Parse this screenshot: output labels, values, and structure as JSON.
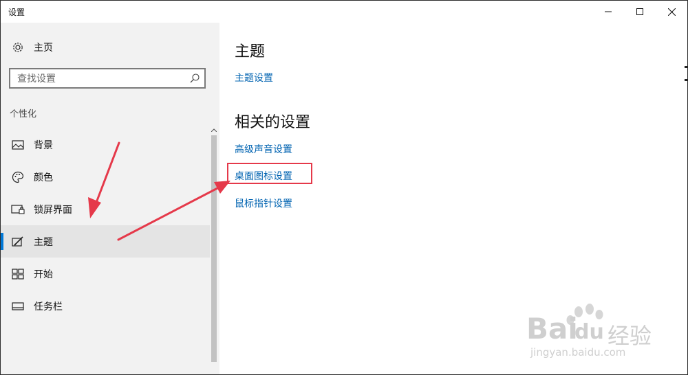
{
  "window": {
    "title": "设置",
    "controls": {
      "minimize_icon": "minimize-icon",
      "maximize_icon": "maximize-icon",
      "close_icon": "close-icon"
    }
  },
  "sidebar": {
    "home_label": "主页",
    "search_placeholder": "查找设置",
    "section_label": "个性化",
    "items": [
      {
        "label": "背景",
        "icon": "picture-icon"
      },
      {
        "label": "颜色",
        "icon": "palette-icon"
      },
      {
        "label": "锁屏界面",
        "icon": "lock-screen-icon"
      },
      {
        "label": "主题",
        "icon": "theme-icon",
        "selected": true
      },
      {
        "label": "开始",
        "icon": "start-icon"
      },
      {
        "label": "任务栏",
        "icon": "taskbar-icon"
      }
    ]
  },
  "main": {
    "title": "主题",
    "theme_settings_link": "主题设置",
    "related_title": "相关的设置",
    "related_links": [
      "高级声音设置",
      "桌面图标设置",
      "鼠标指针设置"
    ]
  },
  "colors": {
    "accent": "#0078d7",
    "link": "#0063b1",
    "annotation": "#e5394a",
    "selected_bg": "#e4e4e4"
  },
  "watermark": {
    "brand": "Bai",
    "brand_suffix": "du",
    "cn_text": "经验",
    "url": "jingyan.baidu.com"
  }
}
